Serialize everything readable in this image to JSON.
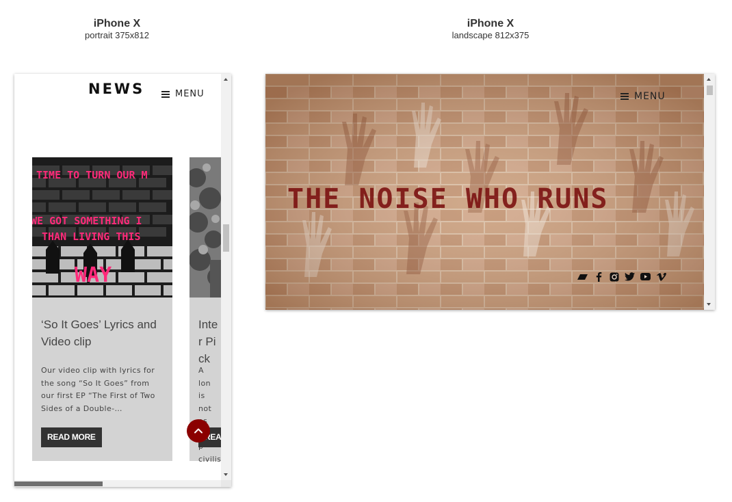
{
  "devices": {
    "portrait": {
      "name": "iPhone X",
      "dims": "portrait 375x812"
    },
    "landscape": {
      "name": "iPhone X",
      "dims": "landscape 812x375"
    }
  },
  "portrait_screen": {
    "header": {
      "title": "NEWS",
      "menu_label": "MENU"
    },
    "cards": [
      {
        "image_text": [
          "TIME TO TURN OUR M",
          "WE GOT SOMETHING I",
          "THAN LIVING THIS",
          "WAY"
        ],
        "title": "‘So It Goes’ Lyrics and Video clip",
        "excerpt": "Our video clip with lyrics for the song “So It Goes” from our first EP “The First of Two Sides of a Double-…",
        "button": "READ MORE"
      },
      {
        "title": "Inter Pick",
        "excerpt": "A lon is not as a p civilis",
        "button": "READ MORE"
      }
    ],
    "scroll_top_icon": "chevron-up-icon"
  },
  "landscape_screen": {
    "menu_label": "MENU",
    "hero_title": "THE NOISE WHO RUNS",
    "social_icons": [
      "bandcamp-icon",
      "facebook-icon",
      "instagram-icon",
      "twitter-icon",
      "youtube-icon",
      "vimeo-icon"
    ]
  },
  "colors": {
    "accent_red": "#8b0000",
    "card_bg": "#d3d3d3",
    "button_bg": "#333333",
    "hero_text": "#7a0f0f",
    "poster_pink": "#ff2a7a"
  }
}
